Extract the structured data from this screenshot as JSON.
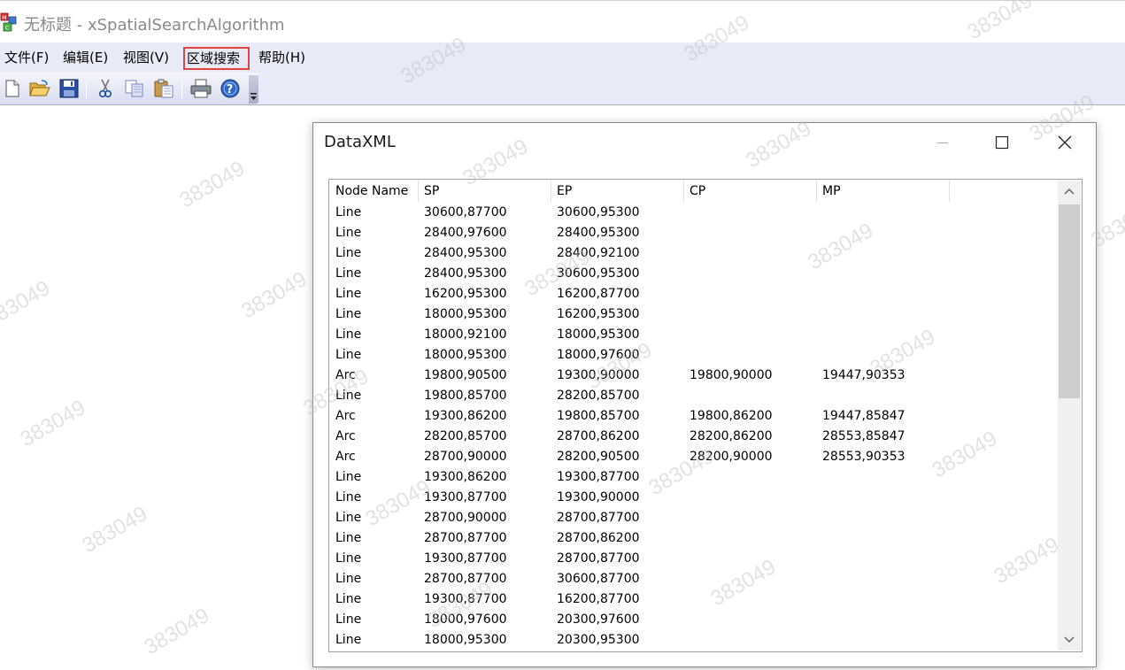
{
  "window": {
    "title": "无标题 - xSpatialSearchAlgorithm"
  },
  "menu": {
    "items": [
      {
        "label": "文件(F)"
      },
      {
        "label": "编辑(E)"
      },
      {
        "label": "视图(V)"
      },
      {
        "label": "区域搜索",
        "highlighted": true
      },
      {
        "label": "帮助(H)"
      }
    ]
  },
  "toolbar": {
    "buttons": [
      "new-icon",
      "open-icon",
      "save-icon",
      "cut-icon",
      "copy-icon",
      "paste-icon",
      "print-icon",
      "help-icon"
    ]
  },
  "dialog": {
    "title": "DataXML",
    "columns": [
      "Node Name",
      "SP",
      "EP",
      "CP",
      "MP"
    ],
    "rows": [
      [
        "Line",
        "30600,87700",
        "30600,95300",
        "",
        ""
      ],
      [
        "Line",
        "28400,97600",
        "28400,95300",
        "",
        ""
      ],
      [
        "Line",
        "28400,95300",
        "28400,92100",
        "",
        ""
      ],
      [
        "Line",
        "28400,95300",
        "30600,95300",
        "",
        ""
      ],
      [
        "Line",
        "16200,95300",
        "16200,87700",
        "",
        ""
      ],
      [
        "Line",
        "18000,95300",
        "16200,95300",
        "",
        ""
      ],
      [
        "Line",
        "18000,92100",
        "18000,95300",
        "",
        ""
      ],
      [
        "Line",
        "18000,95300",
        "18000,97600",
        "",
        ""
      ],
      [
        "Arc",
        "19800,90500",
        "19300,90000",
        "19800,90000",
        "19447,90353"
      ],
      [
        "Line",
        "19800,85700",
        "28200,85700",
        "",
        ""
      ],
      [
        "Arc",
        "19300,86200",
        "19800,85700",
        "19800,86200",
        "19447,85847"
      ],
      [
        "Arc",
        "28200,85700",
        "28700,86200",
        "28200,86200",
        "28553,85847"
      ],
      [
        "Arc",
        "28700,90000",
        "28200,90500",
        "28200,90000",
        "28553,90353"
      ],
      [
        "Line",
        "19300,86200",
        "19300,87700",
        "",
        ""
      ],
      [
        "Line",
        "19300,87700",
        "19300,90000",
        "",
        ""
      ],
      [
        "Line",
        "28700,90000",
        "28700,87700",
        "",
        ""
      ],
      [
        "Line",
        "28700,87700",
        "28700,86200",
        "",
        ""
      ],
      [
        "Line",
        "19300,87700",
        "28700,87700",
        "",
        ""
      ],
      [
        "Line",
        "28700,87700",
        "30600,87700",
        "",
        ""
      ],
      [
        "Line",
        "19300,87700",
        "16200,87700",
        "",
        ""
      ],
      [
        "Line",
        "18000,97600",
        "20300,97600",
        "",
        ""
      ],
      [
        "Line",
        "18000,95300",
        "20300,95300",
        "",
        ""
      ]
    ]
  },
  "watermark": "383049"
}
